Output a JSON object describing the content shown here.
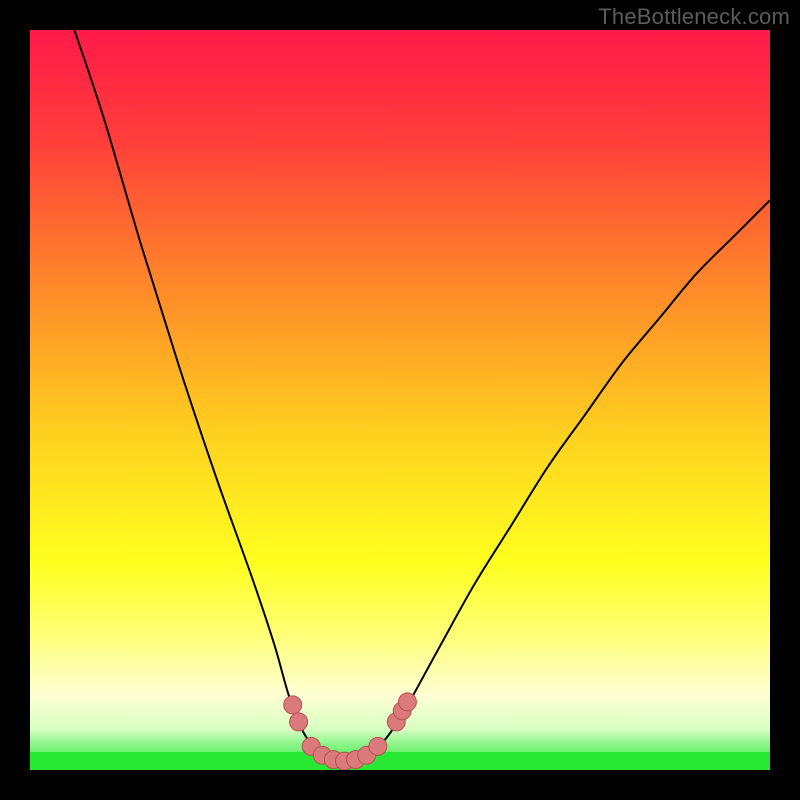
{
  "watermark": "TheBottleneck.com",
  "colors": {
    "background": "#000000",
    "watermark": "#5c5c5c",
    "curve_stroke": "#000000",
    "marker_fill": "#db7a7a",
    "marker_stroke": "#b85050",
    "green_band": "#27e833",
    "gradient_stops": [
      {
        "offset": 0.0,
        "color": "#ff1a49"
      },
      {
        "offset": 0.15,
        "color": "#ff3e3a"
      },
      {
        "offset": 0.35,
        "color": "#ff8a29"
      },
      {
        "offset": 0.55,
        "color": "#ffd21f"
      },
      {
        "offset": 0.72,
        "color": "#ffff1f"
      },
      {
        "offset": 0.82,
        "color": "#ffff7a"
      },
      {
        "offset": 0.9,
        "color": "#fdffd4"
      },
      {
        "offset": 0.945,
        "color": "#d8ffc2"
      },
      {
        "offset": 0.965,
        "color": "#8cf58a"
      },
      {
        "offset": 1.0,
        "color": "#27e833"
      }
    ]
  },
  "chart_data": {
    "type": "line",
    "title": "",
    "xlabel": "",
    "ylabel": "",
    "xlim": [
      0,
      100
    ],
    "ylim": [
      0,
      100
    ],
    "curve": [
      {
        "x": 6,
        "y": 100
      },
      {
        "x": 10,
        "y": 88
      },
      {
        "x": 15,
        "y": 71
      },
      {
        "x": 20,
        "y": 55
      },
      {
        "x": 25,
        "y": 40
      },
      {
        "x": 30,
        "y": 26
      },
      {
        "x": 33,
        "y": 17
      },
      {
        "x": 35,
        "y": 10
      },
      {
        "x": 37,
        "y": 5
      },
      {
        "x": 39,
        "y": 2.5
      },
      {
        "x": 41,
        "y": 1.4
      },
      {
        "x": 43,
        "y": 1.2
      },
      {
        "x": 45,
        "y": 1.6
      },
      {
        "x": 47,
        "y": 3
      },
      {
        "x": 50,
        "y": 7
      },
      {
        "x": 55,
        "y": 16
      },
      {
        "x": 60,
        "y": 25
      },
      {
        "x": 65,
        "y": 33
      },
      {
        "x": 70,
        "y": 41
      },
      {
        "x": 75,
        "y": 48
      },
      {
        "x": 80,
        "y": 55
      },
      {
        "x": 85,
        "y": 61
      },
      {
        "x": 90,
        "y": 67
      },
      {
        "x": 95,
        "y": 72
      },
      {
        "x": 100,
        "y": 77
      }
    ],
    "markers": [
      {
        "x": 35.5,
        "y": 8.8
      },
      {
        "x": 36.3,
        "y": 6.5
      },
      {
        "x": 38.0,
        "y": 3.2
      },
      {
        "x": 39.5,
        "y": 2.0
      },
      {
        "x": 41.0,
        "y": 1.4
      },
      {
        "x": 42.5,
        "y": 1.2
      },
      {
        "x": 44.0,
        "y": 1.4
      },
      {
        "x": 45.5,
        "y": 2.0
      },
      {
        "x": 47.0,
        "y": 3.2
      },
      {
        "x": 49.5,
        "y": 6.5
      },
      {
        "x": 50.3,
        "y": 8.0
      },
      {
        "x": 51.0,
        "y": 9.2
      }
    ]
  }
}
